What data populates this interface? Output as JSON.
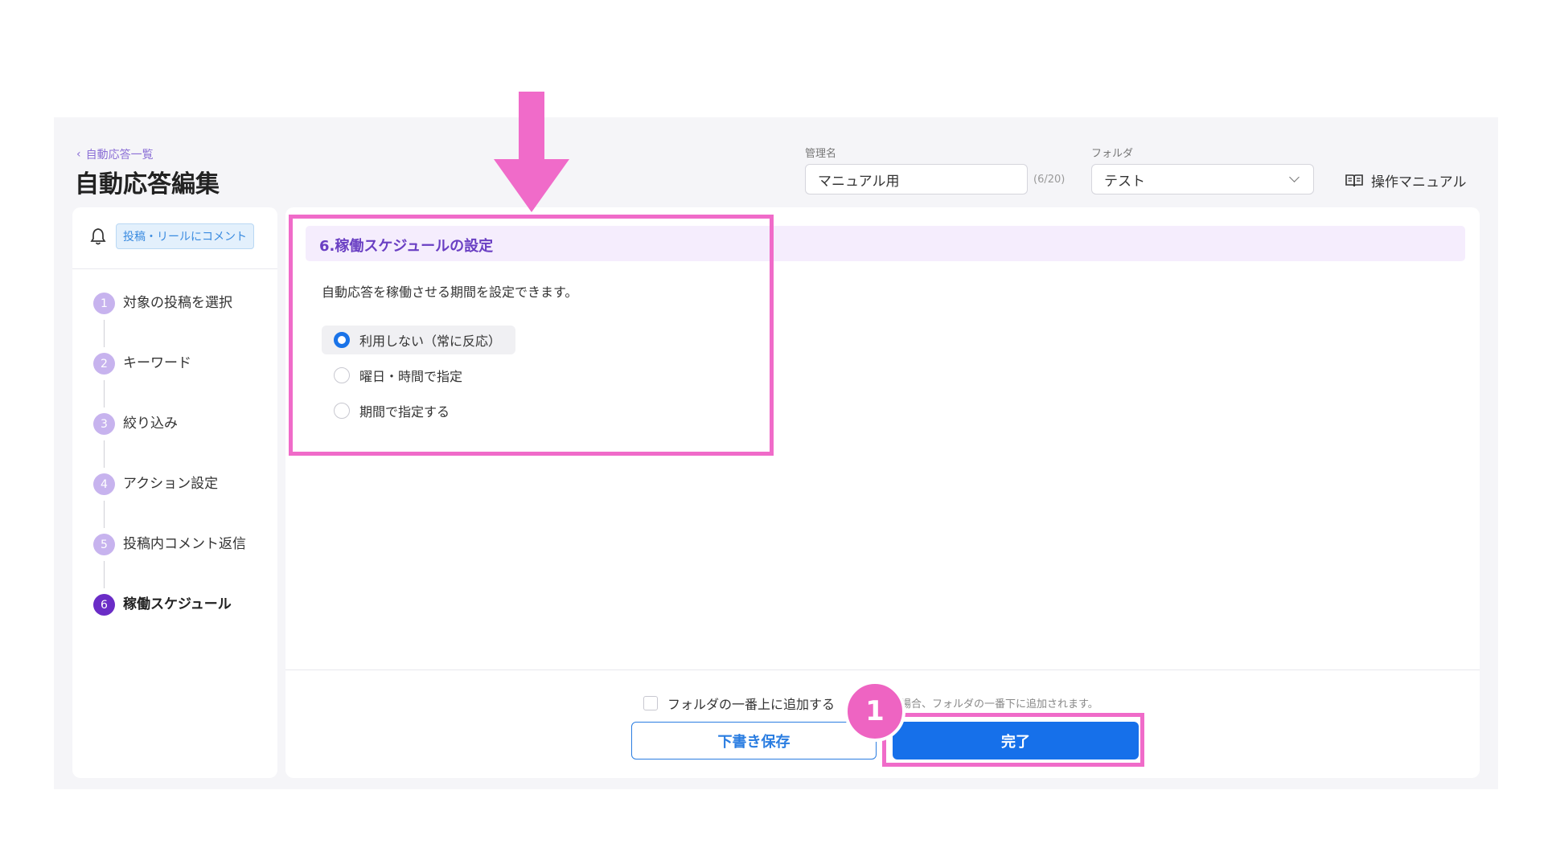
{
  "header": {
    "breadcrumb": "自動応答一覧",
    "title": "自動応答編集",
    "name_label": "管理名",
    "name_value": "マニュアル用",
    "name_counter": "(6/20)",
    "folder_label": "フォルダ",
    "folder_value": "テスト",
    "manual_link": "操作マニュアル"
  },
  "sidebar": {
    "trigger_label": "投稿・リールにコメント",
    "steps": [
      {
        "num": "1",
        "label": "対象の投稿を選択"
      },
      {
        "num": "2",
        "label": "キーワード"
      },
      {
        "num": "3",
        "label": "絞り込み"
      },
      {
        "num": "4",
        "label": "アクション設定"
      },
      {
        "num": "5",
        "label": "投稿内コメント返信"
      },
      {
        "num": "6",
        "label": "稼働スケジュール"
      }
    ]
  },
  "main": {
    "section_title": "6.稼働スケジュールの設定",
    "description": "自動応答を稼働させる期間を設定できます。",
    "options": [
      {
        "label": "利用しない（常に反応）",
        "selected": true
      },
      {
        "label": "曜日・時間で指定",
        "selected": false
      },
      {
        "label": "期間で指定する",
        "selected": false
      }
    ]
  },
  "footer": {
    "checkbox_label": "フォルダの一番上に追加する",
    "hint": "場合、フォルダの一番下に追加されます。",
    "draft_button": "下書き保存",
    "done_button": "完了"
  },
  "annotation": {
    "badge": "1",
    "color": "#f06bc9"
  },
  "colors": {
    "primary": "#1670ea",
    "accent_purple": "#6a2cc6",
    "step_inactive": "#c7b3ee"
  }
}
